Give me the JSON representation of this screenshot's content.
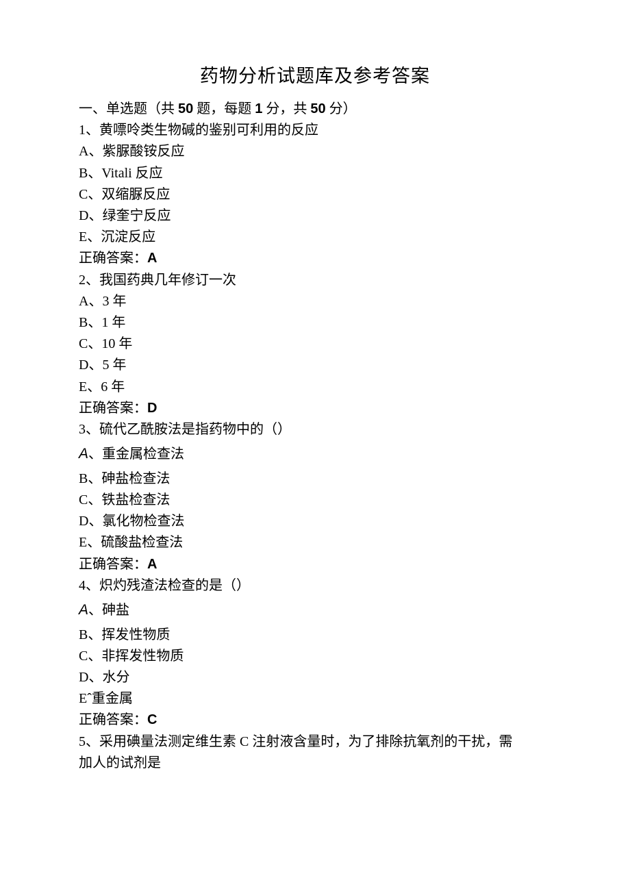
{
  "title": "药物分析试题库及参考答案",
  "section": {
    "prefix": "一、单选题（共 ",
    "count1": "50",
    "mid1": " 题，每题 ",
    "count2": "1",
    "mid2": " 分，共 ",
    "count3": "50",
    "suffix": " 分）"
  },
  "q1": {
    "stem": "1、黄嘌呤类生物碱的鉴别可利用的反应",
    "a": "A、紫脲酸铵反应",
    "b": "B、Vitali 反应",
    "c": "C、双缩脲反应",
    "d": "D、绿奎宁反应",
    "e": "E、沉淀反应",
    "ans_label": "正确答案：",
    "ans_value": "A"
  },
  "q2": {
    "stem": "2、我国药典几年修订一次",
    "a": "A、3 年",
    "b": "B、1 年",
    "c": "C、10 年",
    "d": "D、5 年",
    "e": "E、6 年",
    "ans_label": "正确答案：",
    "ans_value": "D"
  },
  "q3": {
    "stem": "3、硫代乙酰胺法是指药物中的（）",
    "a_prefix": "A",
    "a_rest": "、重金属检查法",
    "b": "B、砷盐检查法",
    "c": "C、铁盐检查法",
    "d": "D、氯化物检查法",
    "e": "E、硫酸盐检查法",
    "ans_label": "正确答案：",
    "ans_value": "A"
  },
  "q4": {
    "stem": "4、炽灼残渣法检查的是（）",
    "a_prefix": "A",
    "a_rest": "、砷盐",
    "b": "B、挥发性物质",
    "c": "C、非挥发性物质",
    "d": "D、水分",
    "e": "Eˆ重金属",
    "ans_label": "正确答案：",
    "ans_value": "C"
  },
  "q5": {
    "stem1": "5、采用碘量法测定维生素 C 注射液含量时，为了排除抗氧剂的干扰，需",
    "stem2": "加人的试剂是"
  }
}
